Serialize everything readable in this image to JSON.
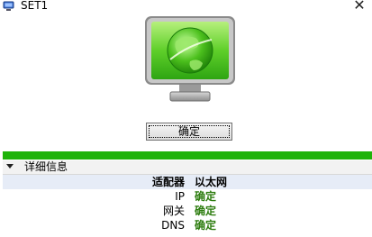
{
  "window": {
    "title": "SET1",
    "close_symbol": "✕"
  },
  "main": {
    "ok_label": "确定"
  },
  "details": {
    "title": "详细信息",
    "header": {
      "key": "适配器",
      "value": "以太网"
    },
    "rows": [
      {
        "key": "IP",
        "value": "确定"
      },
      {
        "key": "网关",
        "value": "确定"
      },
      {
        "key": "DNS",
        "value": "确定"
      }
    ]
  },
  "colors": {
    "status_bar": "#1fb30a",
    "value_text": "#2e7d10",
    "monitor_screen": "#6fd23a"
  },
  "icons": [
    "app-icon",
    "monitor-globe-icon",
    "close-icon",
    "collapse-arrow-icon"
  ]
}
